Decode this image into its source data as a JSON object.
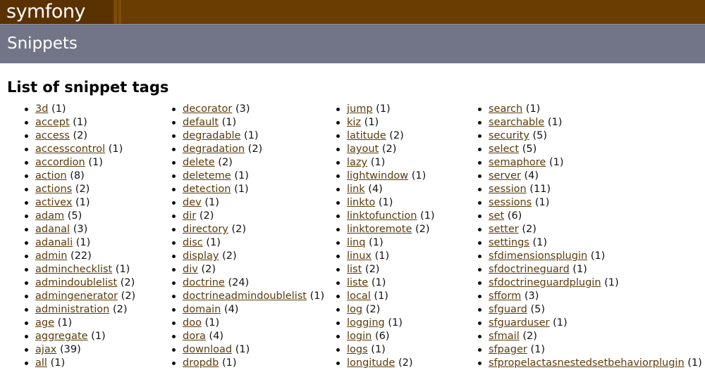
{
  "header": {
    "logo_text": "symfony",
    "section_title": "Snippets"
  },
  "page": {
    "title": "List of snippet tags"
  },
  "columns": [
    [
      {
        "tag": "3d",
        "count": "(1)"
      },
      {
        "tag": "accept",
        "count": "(1)"
      },
      {
        "tag": "access",
        "count": "(2)"
      },
      {
        "tag": "accesscontrol",
        "count": "(1)"
      },
      {
        "tag": "accordion",
        "count": "(1)"
      },
      {
        "tag": "action",
        "count": "(8)"
      },
      {
        "tag": "actions",
        "count": "(2)"
      },
      {
        "tag": "activex",
        "count": "(1)"
      },
      {
        "tag": "adam",
        "count": "(5)"
      },
      {
        "tag": "adanal",
        "count": "(3)"
      },
      {
        "tag": "adanali",
        "count": "(1)"
      },
      {
        "tag": "admin",
        "count": "(22)"
      },
      {
        "tag": "adminchecklist",
        "count": "(1)"
      },
      {
        "tag": "admindoublelist",
        "count": "(2)"
      },
      {
        "tag": "admingenerator",
        "count": "(2)"
      },
      {
        "tag": "administration",
        "count": "(2)"
      },
      {
        "tag": "age",
        "count": "(1)"
      },
      {
        "tag": "aggregate",
        "count": "(1)"
      },
      {
        "tag": "ajax",
        "count": "(39)"
      },
      {
        "tag": "all",
        "count": "(1)"
      }
    ],
    [
      {
        "tag": "decorator",
        "count": "(3)"
      },
      {
        "tag": "default",
        "count": "(1)"
      },
      {
        "tag": "degradable",
        "count": "(1)"
      },
      {
        "tag": "degradation",
        "count": "(2)"
      },
      {
        "tag": "delete",
        "count": "(2)"
      },
      {
        "tag": "deleteme",
        "count": "(1)"
      },
      {
        "tag": "detection",
        "count": "(1)"
      },
      {
        "tag": "dev",
        "count": "(1)"
      },
      {
        "tag": "dir",
        "count": "(2)"
      },
      {
        "tag": "directory",
        "count": "(2)"
      },
      {
        "tag": "disc",
        "count": "(1)"
      },
      {
        "tag": "display",
        "count": "(2)"
      },
      {
        "tag": "div",
        "count": "(2)"
      },
      {
        "tag": "doctrine",
        "count": "(24)"
      },
      {
        "tag": "doctrineadmindoublelist",
        "count": "(1)"
      },
      {
        "tag": "domain",
        "count": "(4)"
      },
      {
        "tag": "doo",
        "count": "(1)"
      },
      {
        "tag": "dora",
        "count": "(4)"
      },
      {
        "tag": "download",
        "count": "(1)"
      },
      {
        "tag": "dropdb",
        "count": "(1)"
      }
    ],
    [
      {
        "tag": "jump",
        "count": "(1)"
      },
      {
        "tag": "kiz",
        "count": "(1)"
      },
      {
        "tag": "latitude",
        "count": "(2)"
      },
      {
        "tag": "layout",
        "count": "(2)"
      },
      {
        "tag": "lazy",
        "count": "(1)"
      },
      {
        "tag": "lightwindow",
        "count": "(1)"
      },
      {
        "tag": "link",
        "count": "(4)"
      },
      {
        "tag": "linkto",
        "count": "(1)"
      },
      {
        "tag": "linktofunction",
        "count": "(1)"
      },
      {
        "tag": "linktoremote",
        "count": "(2)"
      },
      {
        "tag": "linq",
        "count": "(1)"
      },
      {
        "tag": "linux",
        "count": "(1)"
      },
      {
        "tag": "list",
        "count": "(2)"
      },
      {
        "tag": "liste",
        "count": "(1)"
      },
      {
        "tag": "local",
        "count": "(1)"
      },
      {
        "tag": "log",
        "count": "(2)"
      },
      {
        "tag": "logging",
        "count": "(1)"
      },
      {
        "tag": "login",
        "count": "(6)"
      },
      {
        "tag": "logs",
        "count": "(1)"
      },
      {
        "tag": "longitude",
        "count": "(2)"
      }
    ],
    [
      {
        "tag": "search",
        "count": "(1)"
      },
      {
        "tag": "searchable",
        "count": "(1)"
      },
      {
        "tag": "security",
        "count": "(5)"
      },
      {
        "tag": "select",
        "count": "(5)"
      },
      {
        "tag": "semaphore",
        "count": "(1)"
      },
      {
        "tag": "server",
        "count": "(4)"
      },
      {
        "tag": "session",
        "count": "(11)"
      },
      {
        "tag": "sessions",
        "count": "(1)"
      },
      {
        "tag": "set",
        "count": "(6)"
      },
      {
        "tag": "setter",
        "count": "(2)"
      },
      {
        "tag": "settings",
        "count": "(1)"
      },
      {
        "tag": "sfdimensionsplugin",
        "count": "(1)"
      },
      {
        "tag": "sfdoctrineguard",
        "count": "(1)"
      },
      {
        "tag": "sfdoctrineguardplugin",
        "count": "(1)"
      },
      {
        "tag": "sfform",
        "count": "(3)"
      },
      {
        "tag": "sfguard",
        "count": "(5)"
      },
      {
        "tag": "sfguarduser",
        "count": "(1)"
      },
      {
        "tag": "sfmail",
        "count": "(2)"
      },
      {
        "tag": "sfpager",
        "count": "(1)"
      },
      {
        "tag": "sfpropelactasnestedsetbehaviorplugin",
        "count": "(1)"
      }
    ]
  ]
}
